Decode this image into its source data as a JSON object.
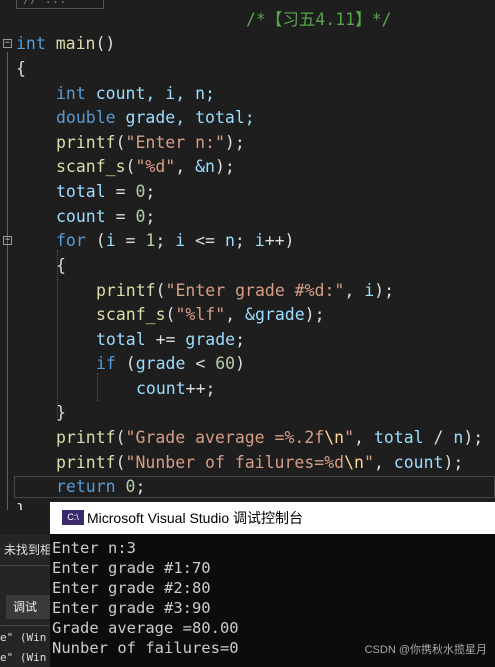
{
  "editor": {
    "prev_region_label": "// ...",
    "comment": "/*【习五4.11】*/",
    "func_kw": "int",
    "func_name": "main",
    "func_parens": "()",
    "open_brace": "{",
    "decl1_kw": "int",
    "decl1_vars": "count, i, n;",
    "decl2_kw": "double",
    "decl2_vars": "grade, total;",
    "printf": "printf",
    "scanf": "scanf_s",
    "s_enter_n": "\"Enter n:\"",
    "s_fmt_d": "\"%d\"",
    "amp_n": "&n",
    "total": "total",
    "count": "count",
    "zero": "0",
    "one": "1",
    "sixty": "60",
    "for_kw": "for",
    "i": "i",
    "n": "n",
    "if_kw": "if",
    "grade": "grade",
    "s_enter_grade": "\"Enter grade #%d:\"",
    "s_fmt_lf": "\"%lf\"",
    "amp_grade": "&grade",
    "s_avg_a": "\"Grade average =%.2f",
    "s_fail_a": "\"Nunber of failures=%d",
    "esc_n": "\\n",
    "quote": "\"",
    "return_kw": "return",
    "close_brace": "}"
  },
  "console": {
    "title": "Microsoft Visual Studio 调试控制台",
    "icon_text": "C:\\",
    "lines": [
      "Enter n:3",
      "Enter grade #1:70",
      "Enter grade #2:80",
      "Enter grade #3:90",
      "Grade average =80.00",
      "Nunber of failures=0"
    ]
  },
  "left_panel": {
    "not_found": "未找到相",
    "debug_btn": "调试",
    "out1": "e\" (Win",
    "out2": "e\" (Win"
  },
  "watermark": "CSDN @你携秋水揽星月"
}
